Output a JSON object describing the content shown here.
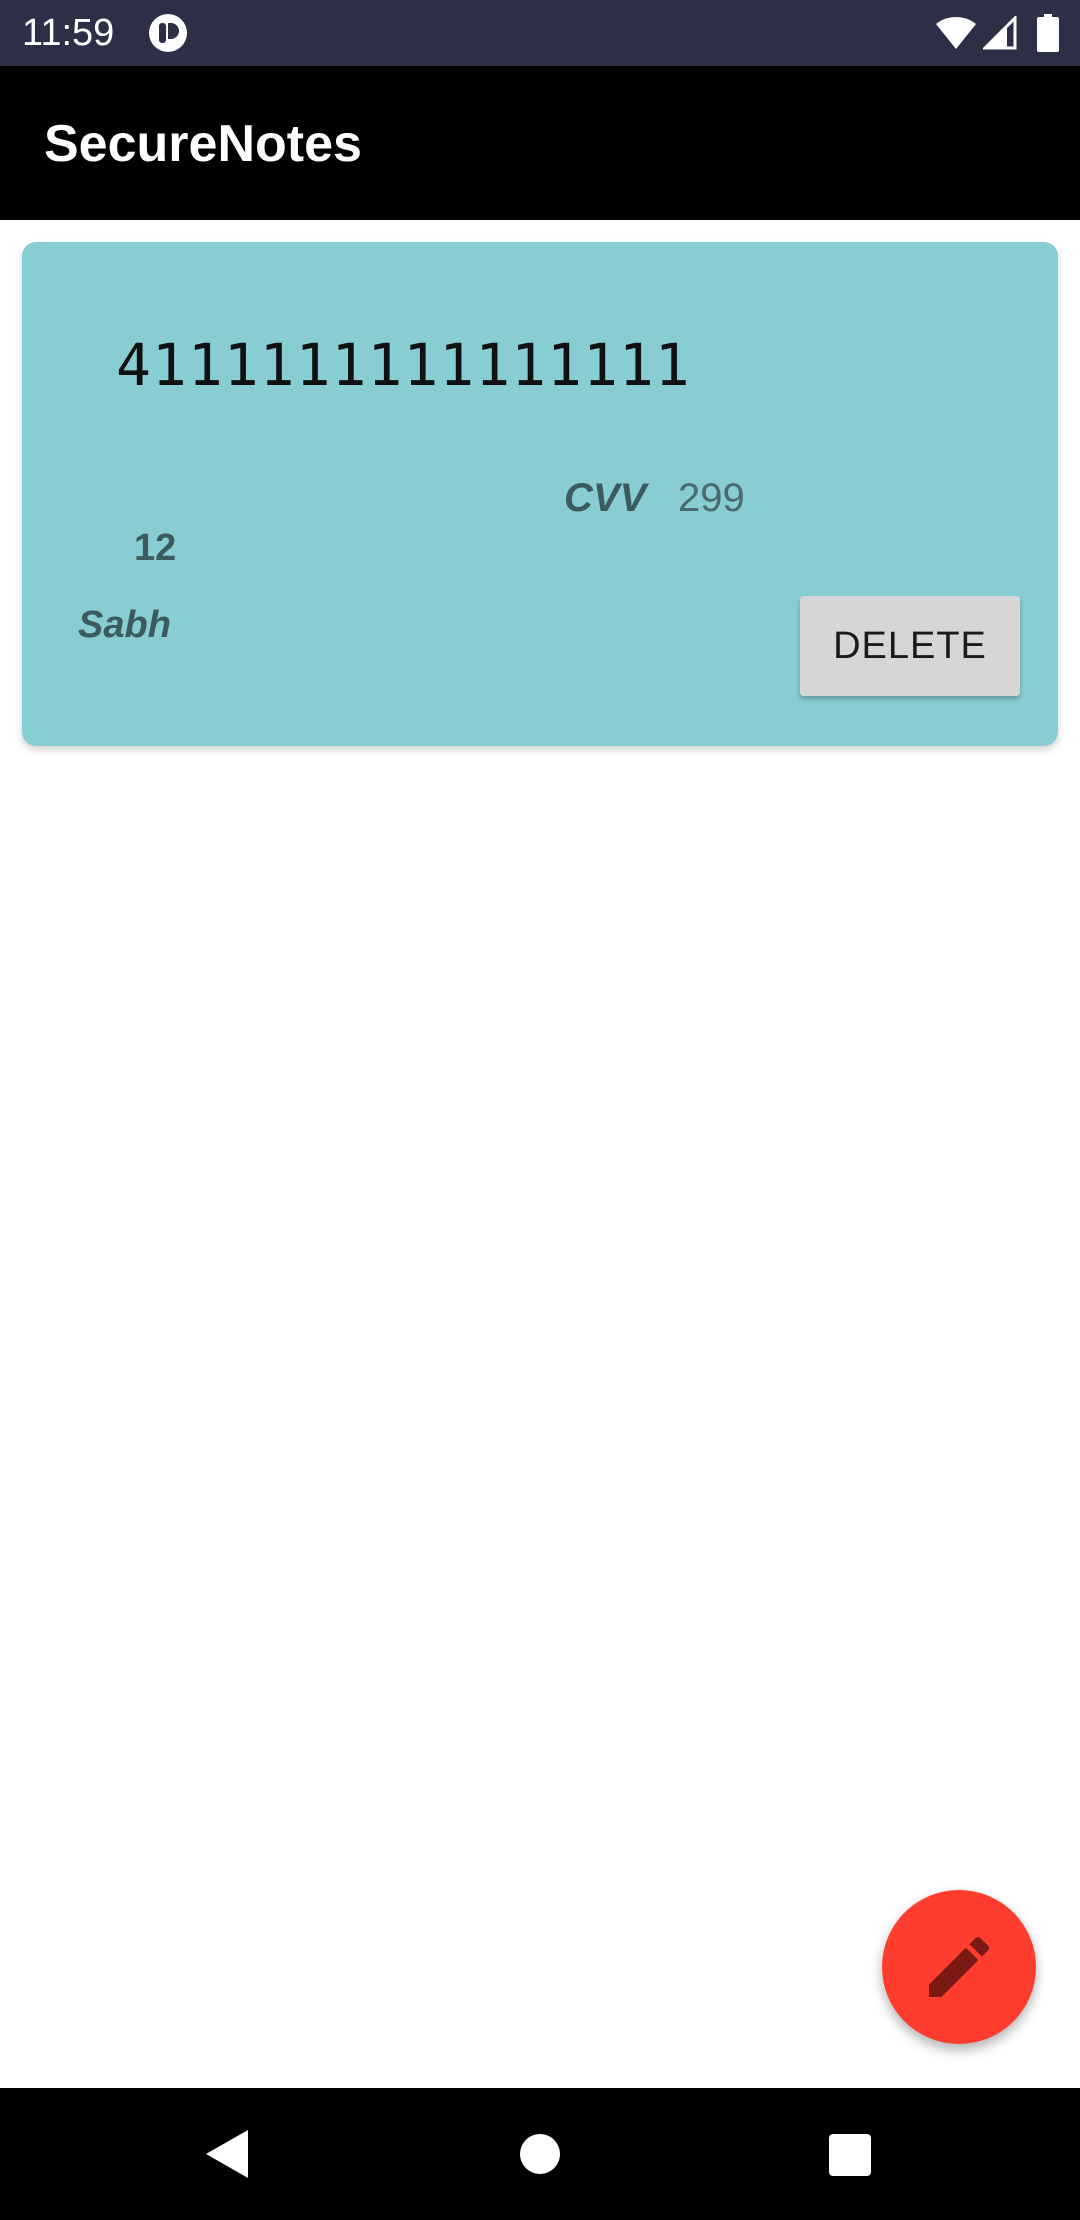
{
  "status_bar": {
    "time": "11:59",
    "icons": [
      "app-notification-icon",
      "wifi-icon",
      "cell-signal-icon",
      "battery-icon"
    ]
  },
  "app_bar": {
    "title": "SecureNotes"
  },
  "cards": [
    {
      "number": "4111111111111111",
      "cvv_label": "CVV",
      "cvv_value": "299",
      "expiry": "12",
      "name": "Sabh",
      "delete_label": "DELETE",
      "color": "#87cdd2"
    }
  ],
  "fab": {
    "icon": "pencil-icon",
    "color": "#ff3d2e"
  },
  "nav_bar": {
    "icons": [
      "back-icon",
      "home-icon",
      "recents-icon"
    ]
  }
}
